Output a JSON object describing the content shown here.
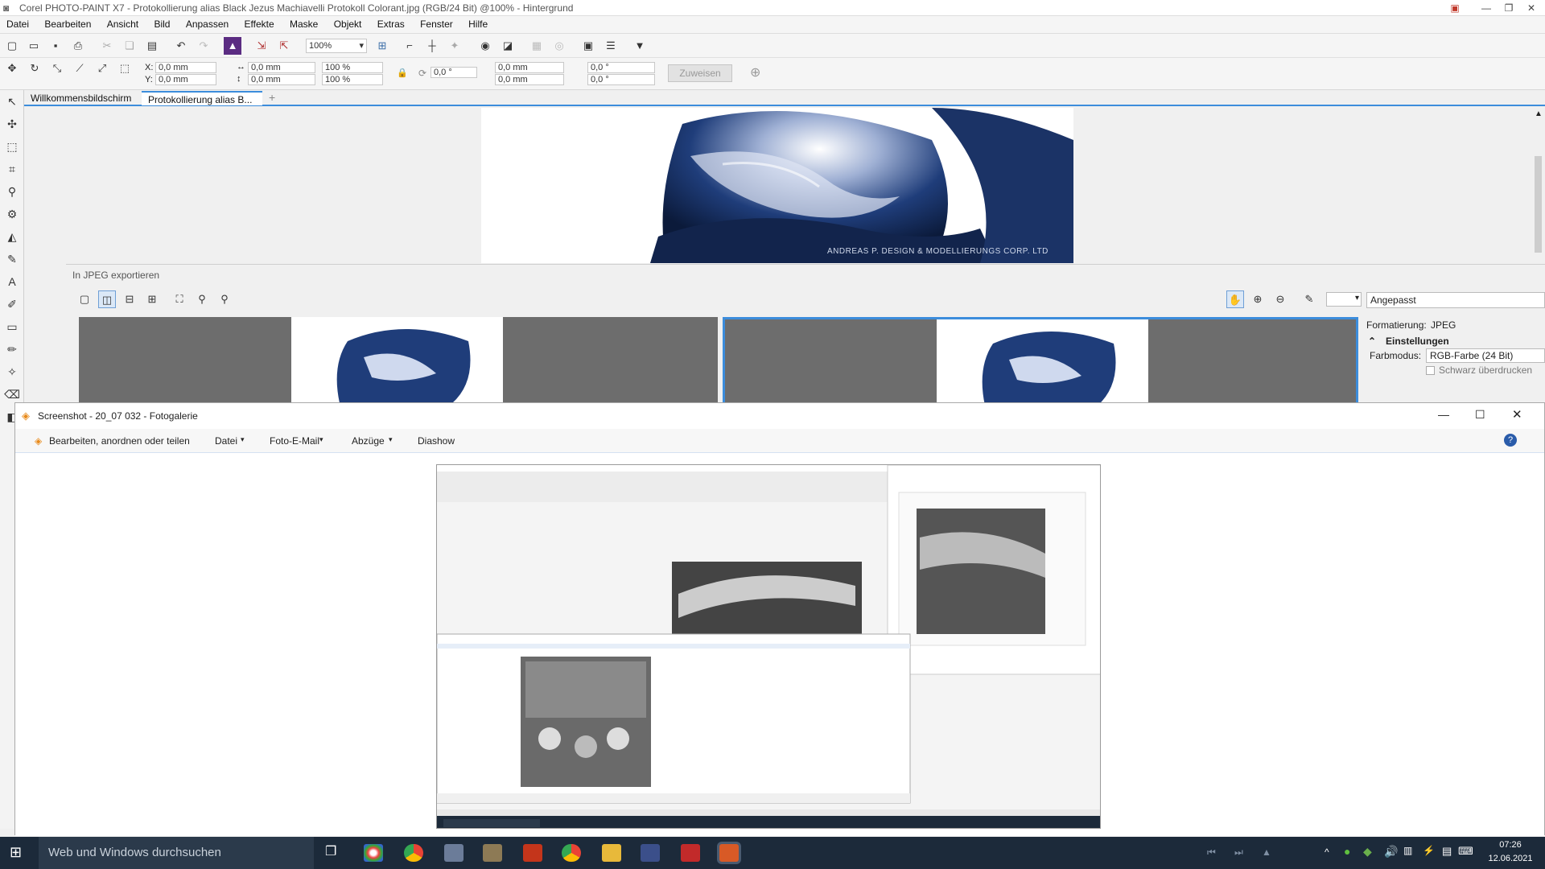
{
  "app": {
    "title": "Corel PHOTO-PAINT X7 - Protokollierung alias Black Jezus Machiavelli Protokoll Colorant.jpg (RGB/24 Bit) @100% - Hintergrund",
    "minimize": "—",
    "restore": "❐",
    "close": "✕"
  },
  "menu": [
    "Datei",
    "Bearbeiten",
    "Ansicht",
    "Bild",
    "Anpassen",
    "Effekte",
    "Maske",
    "Objekt",
    "Extras",
    "Fenster",
    "Hilfe"
  ],
  "toolbar": {
    "zoom": "100%",
    "x_label": "X:",
    "y_label": "Y:",
    "x_value": "0,0 mm",
    "y_value": "0,0 mm",
    "w_value": "0,0 mm",
    "h_value": "0,0 mm",
    "scale_x": "100 %",
    "scale_y": "100 %",
    "rotate": "0,0 °",
    "cx": "0,0 mm",
    "cy": "0,0 mm",
    "skew_x": "0,0 °",
    "skew_y": "0,0 °",
    "assign": "Zuweisen"
  },
  "doc_tabs": [
    "Willkommensbildschirm",
    "Protokollierung alias B..."
  ],
  "watermark": "ANDREAS P. DESIGN & MODELLIERUNGS CORP. LTD",
  "export": {
    "title": "In JPEG exportieren",
    "preset": "Angepasst",
    "format_label": "Formatierung:",
    "format_value": "JPEG",
    "settings": "Einstellungen",
    "color_mode_label": "Farbmodus:",
    "color_mode_value": "RGB-Farbe (24 Bit)",
    "overprint": "Schwarz überdrucken"
  },
  "gallery": {
    "title": "Screenshot - 20_07 032 - Fotogalerie",
    "commands": [
      "Bearbeiten, anordnen oder teilen",
      "Datei",
      "Foto-E-Mail",
      "Abzüge",
      "Diashow"
    ]
  },
  "taskbar": {
    "search_placeholder": "Web und Windows durchsuchen",
    "time": "07:26",
    "date": "12.06.2021"
  },
  "colors": {
    "accent": "#3c8ddc",
    "taskbar": "#1c2a3a",
    "photo_blue": "#1f3d7a"
  }
}
